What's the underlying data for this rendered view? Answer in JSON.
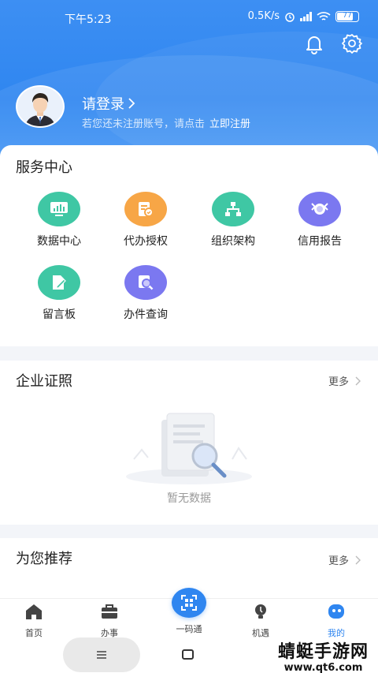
{
  "status_bar": {
    "time": "下午5:23",
    "speed": "0.5K/s",
    "battery": "77"
  },
  "profile": {
    "login_title": "请登录",
    "login_hint": "若您还未注册账号，请点击",
    "register_link": "立即注册"
  },
  "service_center": {
    "title": "服务中心",
    "items": [
      {
        "label": "数据中心",
        "icon": "chart-screen-icon",
        "color": "#3fc7a4"
      },
      {
        "label": "代办授权",
        "icon": "authorize-document-icon",
        "color": "#f7a646"
      },
      {
        "label": "组织架构",
        "icon": "org-chart-icon",
        "color": "#3fc7a4"
      },
      {
        "label": "信用报告",
        "icon": "credit-report-icon",
        "color": "#7b78f0"
      },
      {
        "label": "留言板",
        "icon": "message-board-icon",
        "color": "#3fc7a4"
      },
      {
        "label": "办件查询",
        "icon": "search-document-icon",
        "color": "#7b78f0"
      }
    ]
  },
  "enterprise_certs": {
    "title": "企业证照",
    "more": "更多",
    "empty_text": "暂无数据"
  },
  "recommend": {
    "title": "为您推荐",
    "more": "更多"
  },
  "bottom_nav": {
    "items": [
      {
        "label": "首页",
        "icon": "home-icon"
      },
      {
        "label": "办事",
        "icon": "briefcase-icon"
      },
      {
        "label": "一码通",
        "icon": "qr-code-icon"
      },
      {
        "label": "机遇",
        "icon": "lightbulb-icon"
      },
      {
        "label": "我的",
        "icon": "user-icon",
        "active": true
      }
    ]
  },
  "watermark": {
    "brand": "蜻蜓手游网",
    "url": "www.qt6.com"
  },
  "colors": {
    "primary": "#2f86f0",
    "teal": "#3fc7a4",
    "orange": "#f7a646",
    "purple": "#7b78f0"
  }
}
